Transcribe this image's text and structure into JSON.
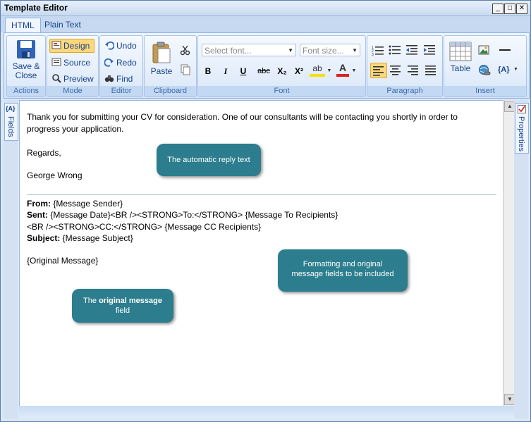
{
  "window": {
    "title": "Template Editor",
    "minimize": "_",
    "maximize": "□",
    "close": "✕"
  },
  "tabs": [
    {
      "label": "HTML"
    },
    {
      "label": "Plain Text"
    }
  ],
  "ribbon": {
    "actions": {
      "group_label": "Actions",
      "save_close": "Save &\nClose"
    },
    "mode": {
      "group_label": "Mode",
      "design": "Design",
      "source": "Source",
      "preview": "Preview"
    },
    "editor": {
      "group_label": "Editor",
      "undo": "Undo",
      "redo": "Redo",
      "find": "Find"
    },
    "clipboard": {
      "group_label": "Clipboard",
      "paste": "Paste"
    },
    "font": {
      "group_label": "Font",
      "font_placeholder": "Select font...",
      "size_placeholder": "Font size...",
      "bold": "B",
      "italic": "I",
      "underline": "U",
      "strike": "abc",
      "subscript": "X₂",
      "superscript": "X²",
      "highlight": "ab",
      "color": "A"
    },
    "paragraph": {
      "group_label": "Paragraph"
    },
    "insert": {
      "group_label": "Insert",
      "table": "Table",
      "field_token": "{A}"
    }
  },
  "side": {
    "fields_label": "Fields",
    "fields_token": "{A}",
    "properties_label": "Properties"
  },
  "document": {
    "line1": "Thank you for submitting your CV for consideration. One of our consultants will be contacting you shortly in order to",
    "line2": "progress your application.",
    "regards": "Regards,",
    "signature": "George Wrong",
    "from_label": "From:",
    "from_value": " {Message Sender}",
    "sent_label": "Sent:",
    "sent_value": " {Message Date}<BR /><STRONG>To:</STRONG> {Message To Recipients}",
    "cc_line": "<BR /><STRONG>CC:</STRONG> {Message CC Recipients}",
    "subject_label": "Subject:",
    "subject_value": " {Message Subject}",
    "original": "{Original Message}"
  },
  "callouts": {
    "reply": "The automatic reply text",
    "formatting_line1": "Formatting and original",
    "formatting_line2": "message fields to be included",
    "original_prefix": "The ",
    "original_bold": "original message",
    "original_suffix": "field"
  },
  "colors": {
    "callout": "#2c7d8d",
    "ribbon_text": "#15428b",
    "accent_selected": "#ffd87c"
  }
}
